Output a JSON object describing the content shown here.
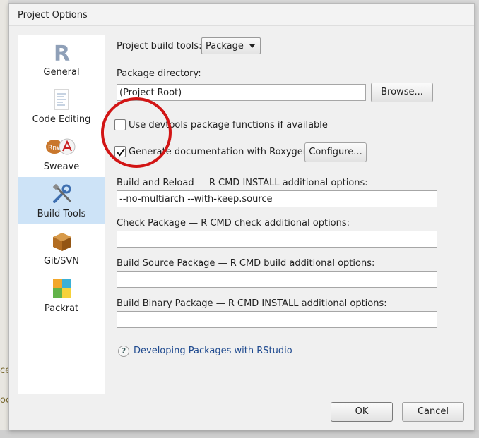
{
  "window": {
    "title": "Project Options"
  },
  "sidebar": {
    "items": [
      {
        "label": "General",
        "icon": "r-logo-icon"
      },
      {
        "label": "Code Editing",
        "icon": "document-icon"
      },
      {
        "label": "Sweave",
        "icon": "sweave-pdf-icon"
      },
      {
        "label": "Build Tools",
        "icon": "tools-icon",
        "selected": true
      },
      {
        "label": "Git/SVN",
        "icon": "box-icon"
      },
      {
        "label": "Packrat",
        "icon": "packrat-icon"
      }
    ]
  },
  "build": {
    "tools_label": "Project build tools:",
    "tools_value": "Package",
    "pkg_dir_label": "Package directory:",
    "pkg_dir_value": "(Project Root)",
    "browse_label": "Browse...",
    "devtools_label": "Use devtools package functions if available",
    "devtools_checked": false,
    "roxygen_label": "Generate documentation with Roxygen",
    "roxygen_checked": true,
    "configure_label": "Configure...",
    "reload_label": "Build and Reload — R CMD INSTALL additional options:",
    "reload_value": "--no-multiarch --with-keep.source",
    "check_label": "Check Package — R CMD check additional options:",
    "check_value": "",
    "source_label": "Build Source Package — R CMD build additional options:",
    "source_value": "",
    "binary_label": "Build Binary Package — R CMD INSTALL additional options:",
    "binary_value": "",
    "help_link": "Developing Packages with RStudio"
  },
  "footer": {
    "ok_label": "OK",
    "cancel_label": "Cancel"
  },
  "colors": {
    "annotation_circle": "#d21515",
    "selected_bg": "#cde3f7",
    "link": "#1f4a8f"
  },
  "background": {
    "fragments": [
      "ce",
      "oc"
    ]
  }
}
